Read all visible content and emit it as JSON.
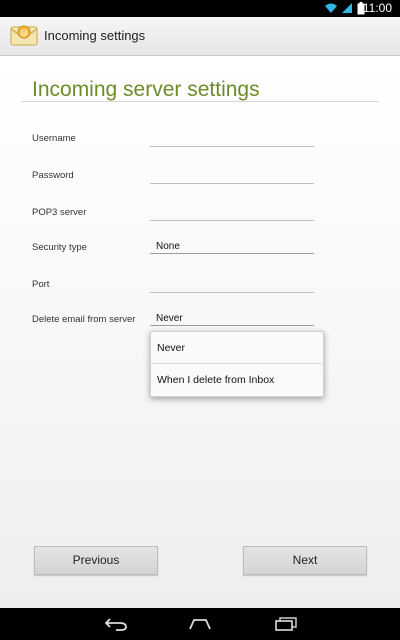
{
  "status_bar": {
    "time": "11:00"
  },
  "app_bar": {
    "title": "Incoming settings",
    "icon": "email-envelope-icon"
  },
  "page": {
    "title": "Incoming server settings"
  },
  "form": {
    "fields": [
      {
        "label": "Username",
        "value": ""
      },
      {
        "label": "Password",
        "value": ""
      },
      {
        "label": "POP3 server",
        "value": ""
      },
      {
        "label": "Security type",
        "value": "None"
      },
      {
        "label": "Port",
        "value": ""
      },
      {
        "label": "Delete email from server",
        "value": "Never"
      }
    ]
  },
  "dropdown": {
    "options": [
      "Never",
      "When I delete from Inbox"
    ]
  },
  "buttons": {
    "previous": "Previous",
    "next": "Next"
  },
  "nav_icons": [
    "back-icon",
    "home-icon",
    "recent-apps-icon"
  ],
  "colors": {
    "title_green": "#6c8c2a"
  }
}
